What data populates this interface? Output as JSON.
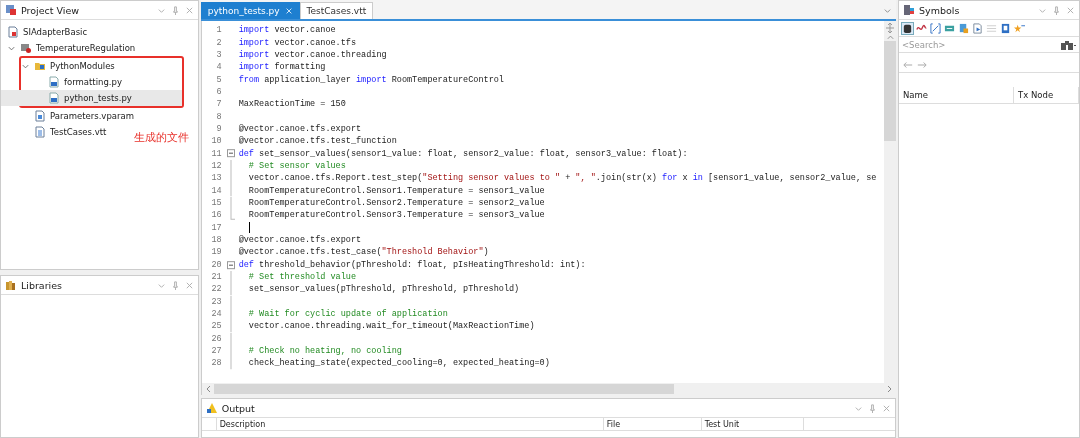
{
  "project_view": {
    "title": "Project View",
    "annotation_label": "生成的文件",
    "tree": [
      {
        "label": "SIAdapterBasic",
        "kind": "config",
        "selected": false
      },
      {
        "label": "TemperatureRegulation",
        "kind": "node",
        "expanded": true,
        "selected": false,
        "children": [
          {
            "label": "PythonModules",
            "kind": "folder",
            "expanded": true,
            "annotated": true,
            "selected": false,
            "children": [
              {
                "label": "formatting.py",
                "kind": "python",
                "selected": false
              },
              {
                "label": "python_tests.py",
                "kind": "python",
                "selected": true
              }
            ]
          },
          {
            "label": "Parameters.vparam",
            "kind": "vparam",
            "selected": false
          },
          {
            "label": "TestCases.vtt",
            "kind": "vtt",
            "selected": false
          }
        ]
      }
    ]
  },
  "libraries": {
    "title": "Libraries"
  },
  "editor": {
    "tabs": [
      {
        "label": "python_tests.py",
        "selected": true
      },
      {
        "label": "TestCases.vtt",
        "selected": false
      }
    ],
    "lines": [
      {
        "n": "1",
        "tokens": [
          {
            "kind": "kw",
            "text": "import"
          },
          {
            "kind": "plain",
            "text": " vector.canoe"
          }
        ]
      },
      {
        "n": "2",
        "tokens": [
          {
            "kind": "kw",
            "text": "import"
          },
          {
            "kind": "plain",
            "text": " vector.canoe.tfs"
          }
        ]
      },
      {
        "n": "3",
        "tokens": [
          {
            "kind": "kw",
            "text": "import"
          },
          {
            "kind": "plain",
            "text": " vector.canoe.threading"
          }
        ]
      },
      {
        "n": "4",
        "tokens": [
          {
            "kind": "kw",
            "text": "import"
          },
          {
            "kind": "plain",
            "text": " formatting"
          }
        ]
      },
      {
        "n": "5",
        "tokens": [
          {
            "kind": "kw",
            "text": "from"
          },
          {
            "kind": "plain",
            "text": " application_layer "
          },
          {
            "kind": "kw",
            "text": "import"
          },
          {
            "kind": "plain",
            "text": " RoomTemperatureControl"
          }
        ]
      },
      {
        "n": "6"
      },
      {
        "n": "7",
        "tokens": [
          {
            "kind": "plain",
            "text": "MaxReactionTime = 150"
          }
        ]
      },
      {
        "n": "8"
      },
      {
        "n": "9",
        "tokens": [
          {
            "kind": "plain",
            "text": "@vector.canoe.tfs.export"
          }
        ]
      },
      {
        "n": "10",
        "tokens": [
          {
            "kind": "plain",
            "text": "@vector.canoe.tfs.test_function"
          }
        ]
      },
      {
        "n": "11",
        "expanded": true,
        "tokens": [
          {
            "kind": "kw",
            "text": "def"
          },
          {
            "kind": "plain",
            "text": " set_sensor_values(sensor1_value: float, sensor2_value: float, sensor3_value: float):"
          }
        ]
      },
      {
        "n": "12",
        "tokens": [
          {
            "kind": "cmt",
            "text": "  # Set sensor values"
          }
        ]
      },
      {
        "n": "13",
        "tokens": [
          {
            "kind": "plain",
            "text": "  vector.canoe.tfs.Report.test_step("
          },
          {
            "kind": "str",
            "text": "\"Setting sensor values to \""
          },
          {
            "kind": "plain",
            "text": " + "
          },
          {
            "kind": "str",
            "text": "\", \""
          },
          {
            "kind": "plain",
            "text": ".join(str(x) "
          },
          {
            "kind": "kw",
            "text": "for"
          },
          {
            "kind": "plain",
            "text": " x "
          },
          {
            "kind": "kw",
            "text": "in"
          },
          {
            "kind": "plain",
            "text": " [sensor1_value, sensor2_value, se"
          }
        ]
      },
      {
        "n": "14",
        "tokens": [
          {
            "kind": "plain",
            "text": "  RoomTemperatureControl.Sensor1.Temperature = sensor1_value"
          }
        ]
      },
      {
        "n": "15",
        "tokens": [
          {
            "kind": "plain",
            "text": "  RoomTemperatureControl.Sensor2.Temperature = sensor2_value"
          }
        ]
      },
      {
        "n": "16",
        "tokens": [
          {
            "kind": "plain",
            "text": "  RoomTemperatureControl.Sensor3.Temperature = sensor3_value"
          }
        ]
      },
      {
        "n": "17",
        "cursor": true
      },
      {
        "n": "18",
        "tokens": [
          {
            "kind": "plain",
            "text": "@vector.canoe.tfs.export"
          }
        ]
      },
      {
        "n": "19",
        "tokens": [
          {
            "kind": "plain",
            "text": "@vector.canoe.tfs.test_case("
          },
          {
            "kind": "str",
            "text": "\"Threshold Behavior\""
          },
          {
            "kind": "plain",
            "text": ")"
          }
        ]
      },
      {
        "n": "20",
        "expanded": true,
        "tokens": [
          {
            "kind": "kw",
            "text": "def"
          },
          {
            "kind": "plain",
            "text": " threshold_behavior(pThreshold: float, pIsHeatingThreshold: int):"
          }
        ]
      },
      {
        "n": "21",
        "tokens": [
          {
            "kind": "cmt",
            "text": "  # Set threshold value"
          }
        ]
      },
      {
        "n": "22",
        "tokens": [
          {
            "kind": "plain",
            "text": "  set_sensor_values(pThreshold, pThreshold, pThreshold)"
          }
        ]
      },
      {
        "n": "23"
      },
      {
        "n": "24",
        "tokens": [
          {
            "kind": "cmt",
            "text": "  # Wait for cyclic update of application"
          }
        ]
      },
      {
        "n": "25",
        "tokens": [
          {
            "kind": "plain",
            "text": "  vector.canoe.threading.wait_for_timeout(MaxReactionTime)"
          }
        ]
      },
      {
        "n": "26"
      },
      {
        "n": "27",
        "tokens": [
          {
            "kind": "cmt",
            "text": "  # Check no heating, no cooling"
          }
        ]
      },
      {
        "n": "28",
        "tokens": [
          {
            "kind": "plain",
            "text": "  check_heating_state(expected_cooling=0, expected_heating=0)"
          }
        ]
      }
    ]
  },
  "output": {
    "title": "Output",
    "columns": [
      "Description",
      "File",
      "Test Unit"
    ]
  },
  "symbols": {
    "title": "Symbols",
    "search": {
      "placeholder": "<Search>"
    },
    "columns": [
      "Name",
      "Tx Node"
    ]
  }
}
